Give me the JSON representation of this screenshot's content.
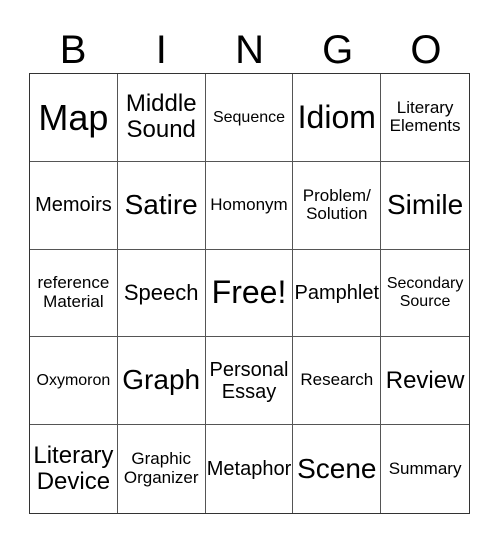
{
  "header": [
    "B",
    "I",
    "N",
    "G",
    "O"
  ],
  "cells": [
    {
      "text": "Map",
      "size": "s36"
    },
    {
      "text": "Middle Sound",
      "size": "s24"
    },
    {
      "text": "Sequence",
      "size": "s16"
    },
    {
      "text": "Idiom",
      "size": "s32"
    },
    {
      "text": "Literary Elements",
      "size": "s17"
    },
    {
      "text": "Memoirs",
      "size": "s20"
    },
    {
      "text": "Satire",
      "size": "s28"
    },
    {
      "text": "Homonym",
      "size": "s17"
    },
    {
      "text": "Problem/ Solution",
      "size": "s17"
    },
    {
      "text": "Simile",
      "size": "s28"
    },
    {
      "text": "reference Material",
      "size": "s17"
    },
    {
      "text": "Speech",
      "size": "s22"
    },
    {
      "text": "Free!",
      "size": "s32"
    },
    {
      "text": "Pamphlet",
      "size": "s20"
    },
    {
      "text": "Secondary Source",
      "size": "s16"
    },
    {
      "text": "Oxymoron",
      "size": "s16"
    },
    {
      "text": "Graph",
      "size": "s28"
    },
    {
      "text": "Personal Essay",
      "size": "s20"
    },
    {
      "text": "Research",
      "size": "s17"
    },
    {
      "text": "Review",
      "size": "s24"
    },
    {
      "text": "Literary Device",
      "size": "s24"
    },
    {
      "text": "Graphic Organizer",
      "size": "s17"
    },
    {
      "text": "Metaphor",
      "size": "s20"
    },
    {
      "text": "Scene",
      "size": "s28"
    },
    {
      "text": "Summary",
      "size": "s17"
    }
  ]
}
